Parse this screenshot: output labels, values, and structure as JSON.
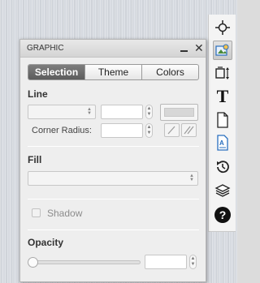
{
  "panel": {
    "title": "GRAPHIC",
    "close_glyph": "✕",
    "tabs": [
      {
        "label": "Selection",
        "active": true
      },
      {
        "label": "Theme",
        "active": false
      },
      {
        "label": "Colors",
        "active": false
      }
    ]
  },
  "line": {
    "heading": "Line",
    "style_value": "",
    "width_value": "",
    "corner_radius_label": "Corner Radius:",
    "corner_radius_value": ""
  },
  "fill": {
    "heading": "Fill",
    "value": ""
  },
  "shadow": {
    "label": "Shadow",
    "checked": false
  },
  "opacity": {
    "heading": "Opacity",
    "value": ""
  },
  "toolbar": {
    "tools": [
      {
        "name": "crosshair-icon"
      },
      {
        "name": "graphic-icon",
        "active": true
      },
      {
        "name": "resize-icon"
      },
      {
        "name": "text-icon",
        "glyph": "T"
      },
      {
        "name": "page-icon"
      },
      {
        "name": "image-text-icon"
      },
      {
        "name": "history-icon"
      },
      {
        "name": "layers-icon"
      },
      {
        "name": "help-icon",
        "glyph": "?"
      }
    ]
  },
  "colors": {
    "active_tab": "#666666",
    "accent_blue": "#2a6fbf"
  }
}
